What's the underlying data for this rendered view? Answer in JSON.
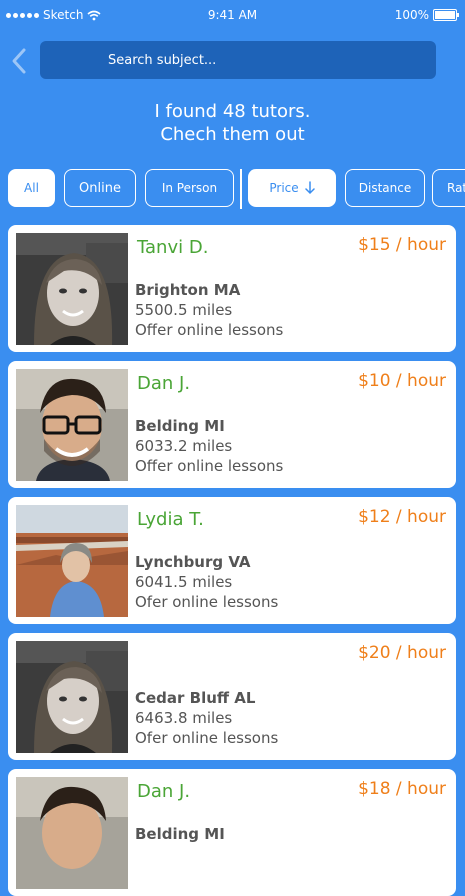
{
  "status_bar": {
    "carrier": "Sketch",
    "time": "9:41 AM",
    "battery": "100%"
  },
  "search": {
    "placeholder": "Search subject..."
  },
  "headline": {
    "line1": "I found 48 tutors.",
    "line2": "Chech them out"
  },
  "filters": {
    "all": "All",
    "online": "Online",
    "in_person": "In Person",
    "price": "Price",
    "distance": "Distance",
    "rating": "Rating",
    "active": "all",
    "sort_arrow_icon": "arrow-down-icon"
  },
  "tutors": [
    {
      "name": "Tanvi D.",
      "price": "$15 / hour",
      "city": "Brighton MA",
      "distance": "5500.5 miles",
      "lessons": "Offer online lessons",
      "photo": "woman-portrait-photo"
    },
    {
      "name": "Dan J.",
      "price": "$10 / hour",
      "city": "Belding MI",
      "distance": "6033.2 miles",
      "lessons": "Offer online lessons",
      "photo": "man-glasses-portrait-photo"
    },
    {
      "name": "Lydia T.",
      "price": "$12 / hour",
      "city": "Lynchburg VA",
      "distance": "6041.5 miles",
      "lessons": "Ofer online lessons",
      "photo": "woman-outdoor-canyon-photo"
    },
    {
      "name": "",
      "price": "$20 / hour",
      "city": "Cedar Bluff AL",
      "distance": "6463.8 miles",
      "lessons": "Ofer online lessons",
      "photo": "woman-portrait-photo"
    },
    {
      "name": "Dan J.",
      "price": "$18 / hour",
      "city": "Belding MI",
      "distance": "",
      "lessons": "",
      "photo": "man-glasses-portrait-photo"
    }
  ],
  "colors": {
    "background": "#3a8ef0",
    "search_bg": "#1e63b8",
    "name": "#4aa536",
    "price": "#ef7f1a",
    "text": "#555555"
  }
}
